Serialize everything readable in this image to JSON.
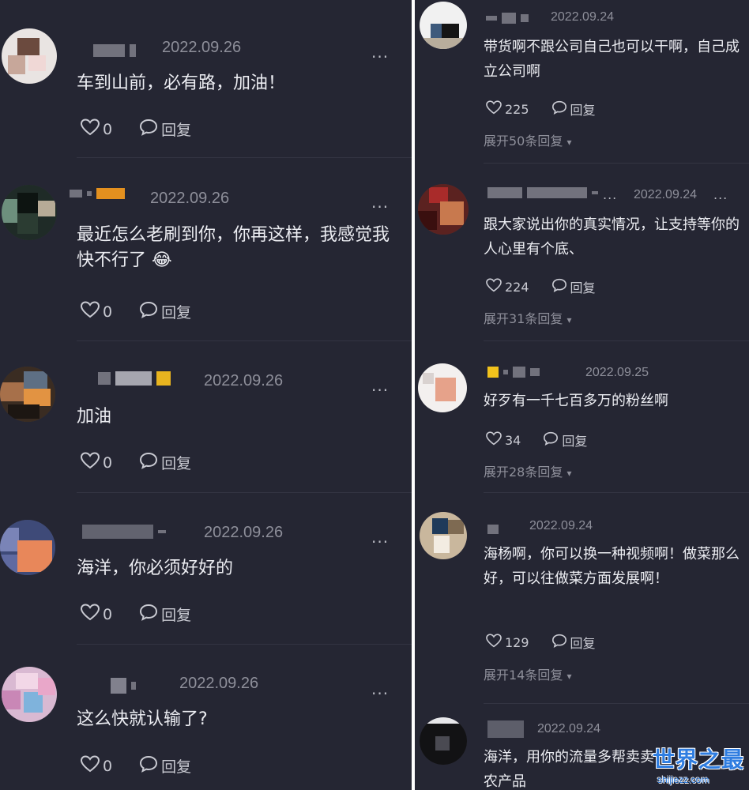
{
  "left_comments": [
    {
      "date": "2022.09.26",
      "text": "车到山前，必有路，加油！",
      "likes": "0",
      "reply_label": "回复"
    },
    {
      "date": "2022.09.26",
      "text": "最近怎么老刷到你，你再这样，我感觉我快不行了 😂",
      "likes": "0",
      "reply_label": "回复"
    },
    {
      "date": "2022.09.26",
      "text": "加油",
      "likes": "0",
      "reply_label": "回复"
    },
    {
      "date": "2022.09.26",
      "text": "海洋，你必须好好的",
      "likes": "0",
      "reply_label": "回复"
    },
    {
      "date": "2022.09.26",
      "text": "这么快就认输了?",
      "likes": "0",
      "reply_label": "回复"
    }
  ],
  "right_comments": [
    {
      "date": "2022.09.24",
      "text": "带货啊不跟公司自己也可以干啊，自己成立公司啊",
      "likes": "225",
      "reply_label": "回复",
      "expand": "展开50条回复"
    },
    {
      "date": "2022.09.24",
      "text": "跟大家说出你的真实情况，让支持等你的人心里有个底、",
      "likes": "224",
      "reply_label": "回复",
      "expand": "展开31条回复"
    },
    {
      "date": "2022.09.25",
      "text": "好歹有一千七百多万的粉丝啊",
      "likes": "34",
      "reply_label": "回复",
      "expand": "展开28条回复"
    },
    {
      "date": "2022.09.24",
      "text": "海杨啊，你可以换一种视频啊！做菜那么好，可以往做菜方面发展啊！",
      "likes": "129",
      "reply_label": "回复",
      "expand": "展开14条回复"
    },
    {
      "date": "2022.09.24",
      "text": "海洋，用你的流量多帮卖卖农产品"
    }
  ],
  "icons": {
    "like": "heart-outline-icon",
    "reply": "speech-bubble-icon",
    "more": "ellipsis-icon",
    "expand": "caret-down-icon"
  },
  "more_glyph": "...",
  "expand_caret": "▾",
  "watermark": {
    "title": "世界之最",
    "url": "shijiezz.com"
  },
  "colors": {
    "background": "#252633",
    "text": "#ecedf2",
    "muted": "#8e8f9a",
    "watermark": "#2f7de0"
  }
}
